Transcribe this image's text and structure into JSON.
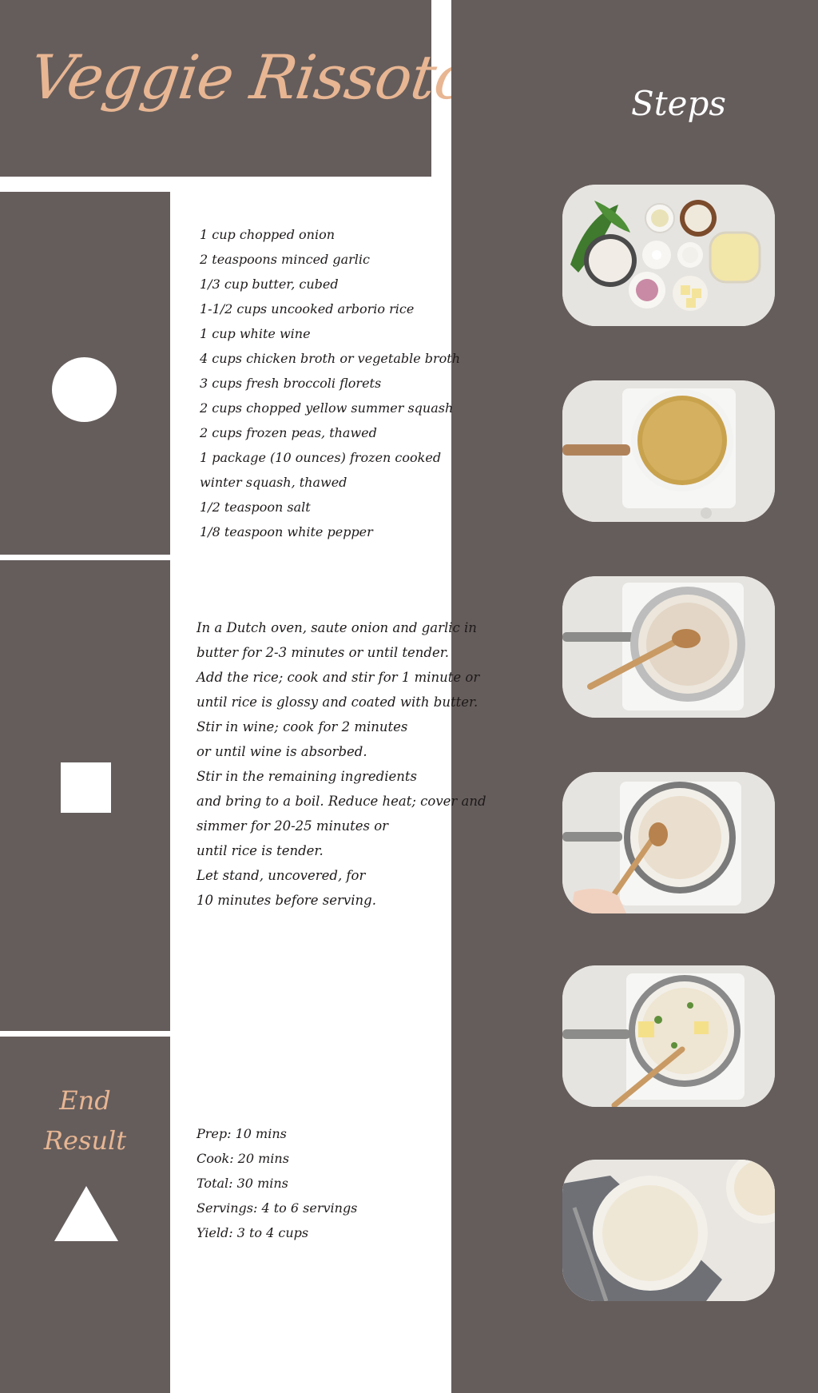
{
  "title": "Veggie Rissoto",
  "steps_heading": "Steps",
  "ingredients": [
    "1 cup chopped onion",
    "2 teaspoons minced garlic",
    "1/3 cup butter, cubed",
    "1-1/2 cups uncooked arborio rice",
    "1 cup white wine",
    "4 cups chicken broth or vegetable broth",
    "3 cups fresh broccoli florets",
    "2 cups chopped yellow summer squash",
    "2 cups frozen peas, thawed",
    "1 package (10 ounces) frozen cooked",
    "winter squash, thawed",
    "1/2 teaspoon salt",
    "1/8 teaspoon white pepper"
  ],
  "instructions": [
    "In a Dutch oven, saute onion and garlic in",
    "butter for 2-3 minutes or until tender.",
    "Add the rice; cook and stir for 1 minute or",
    "until rice is glossy and coated with butter.",
    "Stir in wine; cook for 2 minutes",
    "or until wine is absorbed.",
    "Stir in the remaining ingredients",
    "and bring to a boil. Reduce heat; cover and",
    "simmer for 20-25 minutes or",
    "until rice is tender.",
    "Let stand, uncovered, for",
    "10 minutes before serving."
  ],
  "end_result": {
    "line1": "End",
    "line2": "Result"
  },
  "timing": [
    "Prep: 10 mins",
    "Cook: 20 mins",
    "Total: 30 mins",
    "Servings: 4 to 6 servings",
    "Yield: 3 to 4 cups"
  ],
  "colors": {
    "panel": "#655d5c",
    "accent": "#e8b693",
    "text": "#1e1a1a",
    "background": "#ffffff"
  },
  "photos": [
    "ingredients-photo",
    "broth-pot-photo",
    "rice-toasting-photo",
    "rice-cooking-photo",
    "finished-risotto-pot-photo",
    "served-bowl-photo"
  ]
}
